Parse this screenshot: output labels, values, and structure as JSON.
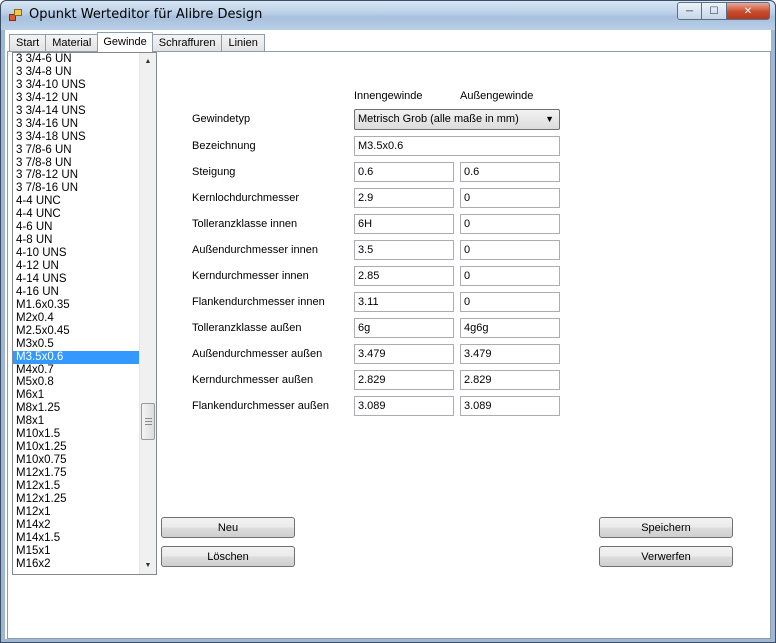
{
  "window": {
    "title": "Opunkt Werteditor für Alibre Design"
  },
  "tabs": [
    "Start",
    "Material",
    "Gewinde",
    "Schraffuren",
    "Linien"
  ],
  "active_tab": "Gewinde",
  "thread_list": {
    "items": [
      "3 3/4-6 UN",
      "3 3/4-8 UN",
      "3 3/4-10 UNS",
      "3 3/4-12 UN",
      "3 3/4-14 UNS",
      "3 3/4-16 UN",
      "3 3/4-18 UNS",
      "3 7/8-6 UN",
      "3 7/8-8 UN",
      "3 7/8-12 UN",
      "3 7/8-16 UN",
      "4-4 UNC",
      "4-4 UNC",
      "4-6 UN",
      "4-8 UN",
      "4-10 UNS",
      "4-12 UN",
      "4-14 UNS",
      "4-16 UN",
      "M1.6x0.35",
      "M2x0.4",
      "M2.5x0.45",
      "M3x0.5",
      "M3.5x0.6",
      "M4x0.7",
      "M5x0.8",
      "M6x1",
      "M8x1.25",
      "M8x1",
      "M10x1.5",
      "M10x1.25",
      "M10x0.75",
      "M12x1.75",
      "M12x1.5",
      "M12x1.25",
      "M12x1",
      "M14x2",
      "M14x1.5",
      "M15x1",
      "M16x2"
    ],
    "selected": "M3.5x0.6",
    "scroll_position": 0.74
  },
  "form": {
    "col_inner": "Innengewinde",
    "col_outer": "Außengewinde",
    "gewindetyp_label": "Gewindetyp",
    "gewindetyp_value": "Metrisch Grob (alle maße in mm)",
    "bezeichnung_label": "Bezeichnung",
    "bezeichnung_value": "M3.5x0.6",
    "rows": [
      {
        "label": "Steigung",
        "inner": "0.6",
        "outer": "0.6"
      },
      {
        "label": "Kernlochdurchmesser",
        "inner": "2.9",
        "outer": "0"
      },
      {
        "label": "Tolleranzklasse innen",
        "inner": "6H",
        "outer": "0"
      },
      {
        "label": "Außendurchmesser innen",
        "inner": "3.5",
        "outer": "0"
      },
      {
        "label": "Kerndurchmesser innen",
        "inner": "2.85",
        "outer": "0"
      },
      {
        "label": "Flankendurchmesser innen",
        "inner": "3.11",
        "outer": "0"
      },
      {
        "label": "Tolleranzklasse außen",
        "inner": "6g",
        "outer": "4g6g"
      },
      {
        "label": "Außendurchmesser außen",
        "inner": "3.479",
        "outer": "3.479"
      },
      {
        "label": "Kerndurchmesser außen",
        "inner": "2.829",
        "outer": "2.829"
      },
      {
        "label": "Flankendurchmesser außen",
        "inner": "3.089",
        "outer": "3.089"
      }
    ]
  },
  "buttons": {
    "neu": "Neu",
    "loeschen": "Löschen",
    "speichern": "Speichern",
    "verwerfen": "Verwerfen"
  },
  "colors": {
    "selection": "#3399ff",
    "titlebar": "#b7cde6",
    "close_button": "#c94a2c"
  },
  "icons": {
    "app": "app-icon",
    "minimize": "minimize-icon",
    "maximize": "maximize-icon",
    "close": "close-icon",
    "dropdown": "chevron-down-icon",
    "scroll_up": "scroll-up-icon",
    "scroll_down": "scroll-down-icon"
  }
}
